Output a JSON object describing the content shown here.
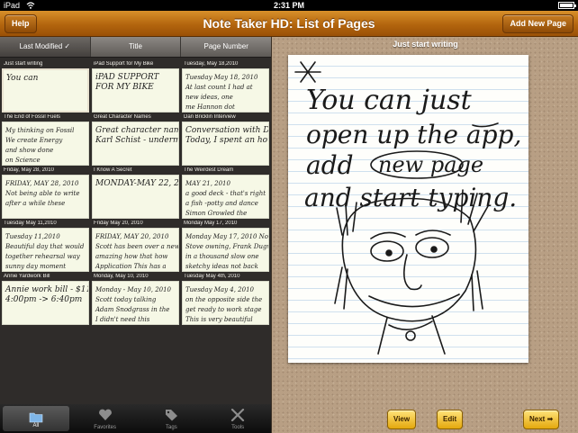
{
  "status": {
    "carrier": "iPad",
    "time": "2:31 PM"
  },
  "titlebar": {
    "title": "Note Taker HD: List of Pages",
    "help_label": "Help",
    "add_label": "Add New Page"
  },
  "sort": {
    "columns": [
      "Last Modified ✓",
      "Title",
      "Page Number"
    ],
    "active_index": 0
  },
  "pages": [
    {
      "title": "Just start writing",
      "scribble": [
        "You can"
      ]
    },
    {
      "title": "iPad Support for My Bike",
      "scribble": [
        "iPAD SUPPORT",
        "FOR MY BIKE"
      ]
    },
    {
      "title": "Tuesday, May 18,2010",
      "scribble": [
        "Tuesday May 18, 2010",
        "At last count I had at",
        "new ideas, one",
        "me Hannon dot"
      ]
    },
    {
      "title": "The End of Fossil Fuels",
      "scribble": [
        "My thinking on Fossil",
        "We create Energy",
        "and show done",
        "on Science"
      ]
    },
    {
      "title": "Great Character Names",
      "scribble": [
        "Great character names",
        "Karl Schist - undermining"
      ]
    },
    {
      "title": "Dan Bricklin Interview",
      "scribble": [
        "Conversation with DAN BR",
        "Today, I spent an hour"
      ]
    },
    {
      "title": "Friday, May 28, 2010",
      "scribble": [
        "FRIDAY, MAY 28, 2010",
        "Not being able to write",
        "after a while these"
      ]
    },
    {
      "title": "I Know A Secret",
      "scribble": [
        "MONDAY-MAY 22, 2010"
      ]
    },
    {
      "title": "The Weirdest Dream",
      "scribble": [
        "MAY 21, 2010",
        "a good deck - that's right",
        "a fish -potty and dance",
        "Simon Growled the"
      ]
    },
    {
      "title": "Tuesday May 11,2010",
      "scribble": [
        "Tuesday 11,2010",
        "Beautiful day that would",
        "together rehearsal way",
        "sunny day moment"
      ]
    },
    {
      "title": "Friday May 20, 2010",
      "scribble": [
        "FRIDAY, MAY 20, 2010",
        "Scott has been over a new",
        "amazing how that how",
        "Application This has a"
      ]
    },
    {
      "title": "Monday May 17, 2010",
      "scribble": [
        "Monday May 17, 2010 Notes",
        "Stove owning, Frank Dugway",
        "in a thousand slow one",
        "sketchy ideas not back"
      ]
    },
    {
      "title": "Annie Yardwork Bill",
      "scribble": [
        "Annie work bill - $11",
        "4:00pm -> 6:40pm"
      ]
    },
    {
      "title": "Monday, May 10, 2010",
      "scribble": [
        "Monday - May 10, 2010",
        "Scott today talking",
        "Adam Snodgrass in the",
        "I didn't need this"
      ]
    },
    {
      "title": "Tuesday May 4th, 2010",
      "scribble": [
        "Tuesday May 4, 2010",
        "on the opposite side the",
        "get ready to work stage",
        "This is very beautiful"
      ]
    }
  ],
  "tabs": [
    {
      "label": "All",
      "icon": "folder-icon"
    },
    {
      "label": "Favorites",
      "icon": "heart-icon"
    },
    {
      "label": "Tags",
      "icon": "tag-icon"
    },
    {
      "label": "Tools",
      "icon": "tools-icon"
    }
  ],
  "tabs_active_index": 0,
  "preview": {
    "title": "Just start writing",
    "handwriting": [
      "You can just",
      "open up the app,",
      "add",
      "new page",
      "and start typing."
    ]
  },
  "actions": {
    "view_label": "View",
    "edit_label": "Edit",
    "next_label": "Next ➡"
  },
  "colors": {
    "accent": "#b3650e",
    "paper": "#fefefb",
    "button_gold": "#e4a80d"
  }
}
